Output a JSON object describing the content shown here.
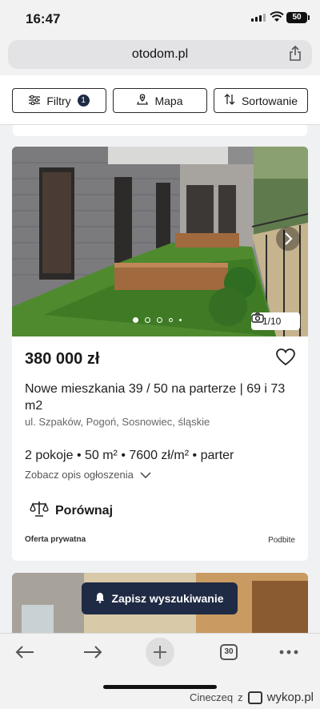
{
  "status_bar": {
    "time": "16:47",
    "battery": "50"
  },
  "browser": {
    "url": "otodom.pl",
    "tabs_count": "30"
  },
  "filters": {
    "filter_label": "Filtry",
    "filter_count": "1",
    "map_label": "Mapa",
    "sort_label": "Sortowanie"
  },
  "listing": {
    "photo_counter": "1/10",
    "price": "380 000 zł",
    "title": "Nowe mieszkania 39 / 50 na parterze | 69 i 73 m2",
    "address": "ul. Szpaków, Pogoń, Sosnowiec, śląskie",
    "specs": "2 pokoje • 50 m² • 7600 zł/m² • parter",
    "see_description": "Zobacz opis ogłoszenia",
    "compare": "Porównaj",
    "owner_type": "Oferta prywatna",
    "bumped": "Podbite"
  },
  "save_search": {
    "label": "Zapisz wyszukiwanie"
  },
  "watermark": {
    "user": "Cineczeq",
    "sep": "z",
    "site": "wykop.pl"
  },
  "icons": [
    "signal-icon",
    "wifi-icon",
    "share-icon",
    "sliders-icon",
    "map-pin-icon",
    "sort-icon",
    "chevron-right-icon",
    "camera-icon",
    "heart-icon",
    "chevron-down-icon",
    "scales-icon",
    "bell-icon",
    "back-arrow-icon",
    "forward-arrow-icon",
    "plus-icon",
    "more-icon"
  ]
}
